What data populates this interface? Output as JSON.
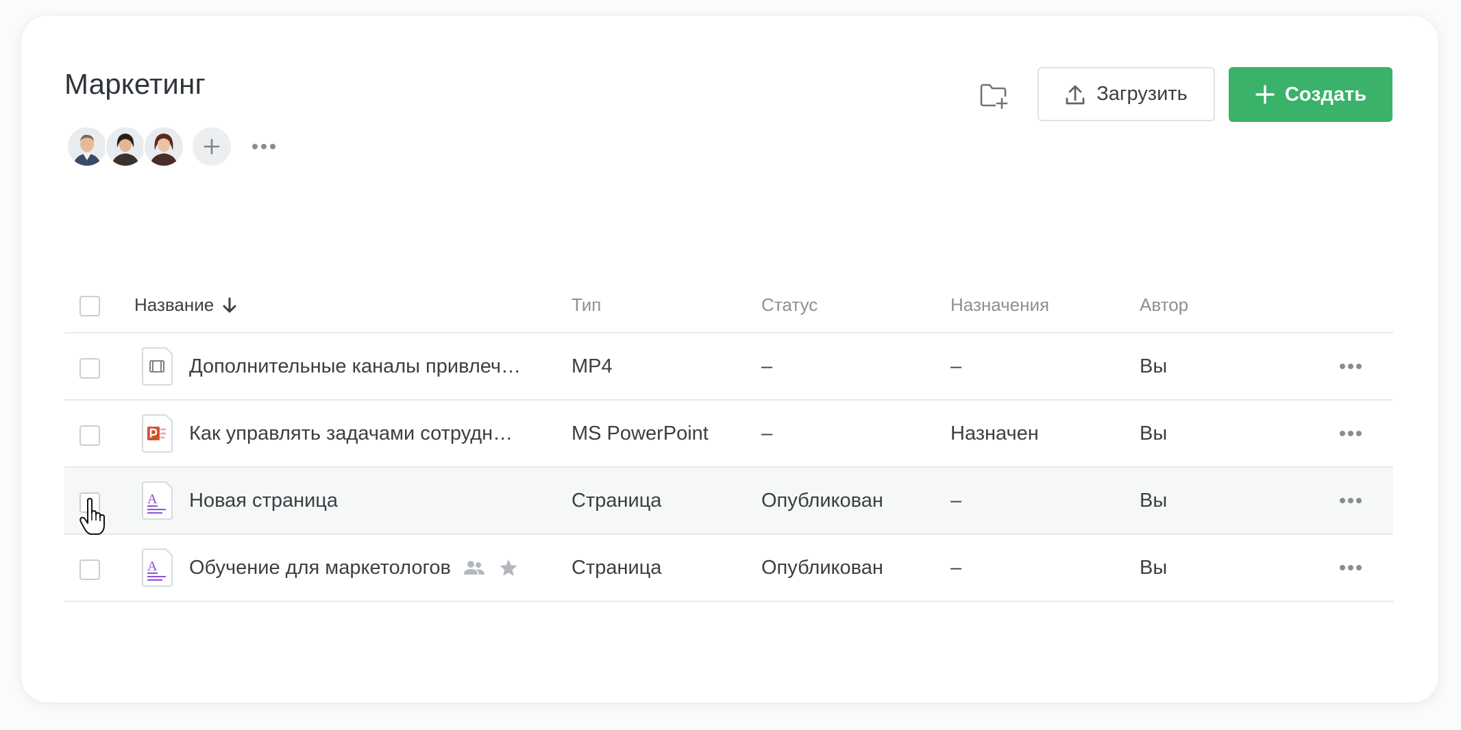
{
  "header": {
    "title": "Маркетинг",
    "members": [
      "avatar-man",
      "avatar-woman-1",
      "avatar-woman-2"
    ]
  },
  "toolbar": {
    "upload_label": "Загрузить",
    "create_label": "Создать",
    "accent_color": "#3ab26a"
  },
  "table": {
    "columns": {
      "name": "Название",
      "type": "Тип",
      "status": "Статус",
      "assign": "Назначения",
      "author": "Автор"
    },
    "rows": [
      {
        "name": "Дополнительные каналы привлеч…",
        "type": "MP4",
        "status": "–",
        "assign": "–",
        "author": "Вы",
        "icon": "video-file-icon"
      },
      {
        "name": "Как управлять задачами сотрудн…",
        "type": "MS PowerPoint",
        "status": "–",
        "assign": "Назначен",
        "author": "Вы",
        "icon": "powerpoint-file-icon"
      },
      {
        "name": "Новая страница",
        "type": "Страница",
        "status": "Опубликован",
        "assign": "–",
        "author": "Вы",
        "icon": "page-file-icon"
      },
      {
        "name": "Обучение для маркетологов",
        "type": "Страница",
        "status": "Опубликован",
        "assign": "–",
        "author": "Вы",
        "icon": "page-file-icon"
      }
    ]
  }
}
